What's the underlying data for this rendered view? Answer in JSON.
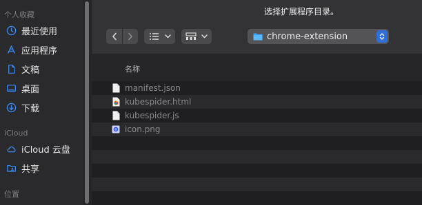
{
  "sidebar": {
    "favorites_title": "个人收藏",
    "favorites": [
      {
        "label": "最近使用",
        "icon": "clock-icon"
      },
      {
        "label": "应用程序",
        "icon": "apps-icon"
      },
      {
        "label": "文稿",
        "icon": "document-icon"
      },
      {
        "label": "桌面",
        "icon": "desktop-icon"
      },
      {
        "label": "下载",
        "icon": "download-icon"
      }
    ],
    "icloud_title": "iCloud",
    "icloud": [
      {
        "label": "iCloud 云盘",
        "icon": "cloud-icon"
      },
      {
        "label": "共享",
        "icon": "shared-folder-icon"
      }
    ],
    "locations_title": "位置"
  },
  "window": {
    "title": "选择扩展程序目录。"
  },
  "toolbar": {
    "path": "chrome-extension",
    "accent": "#2f6fd8"
  },
  "file_list": {
    "column_name": "名称",
    "files": [
      {
        "name": "manifest.json",
        "icon": "document-icon"
      },
      {
        "name": "kubespider.html",
        "icon": "html-file-icon"
      },
      {
        "name": "kubespider.js",
        "icon": "document-icon"
      },
      {
        "name": "icon.png",
        "icon": "image-file-icon"
      }
    ]
  }
}
